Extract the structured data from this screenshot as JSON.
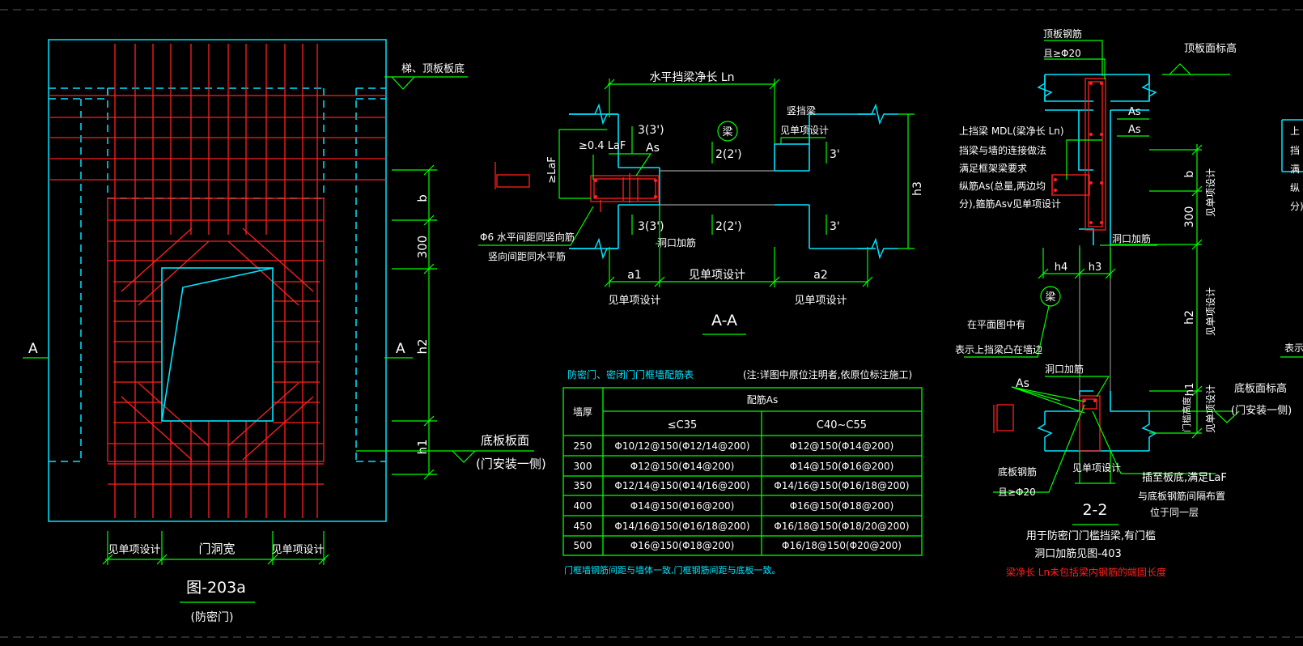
{
  "colors": {
    "background": "#000000",
    "frame_cyan": "#00e5ff",
    "rebar_red": "#ff2020",
    "dim_green": "#00ff00",
    "text_white": "#ffffff",
    "table_green": "#00ff00",
    "note_red": "#ff2020",
    "marker_red": "#ff2020"
  },
  "elevation": {
    "label_top": "梯、顶板板底",
    "label_bottom_1": "底板板面",
    "label_bottom_2": "(门安装一侧)",
    "section_left": "A",
    "section_right": "A",
    "dim_b": "b",
    "dim_300": "300",
    "dim_h2": "h2",
    "dim_h1": "h1",
    "dim_left": "见单项设计",
    "dim_mid": "门洞宽",
    "dim_right": "见单项设计",
    "fig_no": "图-203a",
    "fig_name": "(防密门)"
  },
  "section_aa": {
    "title": "A-A",
    "top_dim": "水平挡梁净长 Ln",
    "beam_mark": "梁",
    "lbl_33_top": "3(3')",
    "lbl_22_top": "2(2')",
    "lbl_3p_top": "3'",
    "lbl_33_bot": "3(3')",
    "lbl_22_bot": "2(2')",
    "lbl_3p_bot": "3'",
    "lbl_04laf": "≥0.4 LaF",
    "lbl_as": "As",
    "lbl_laf": "≥LaF",
    "lbl_vert_1": "竖挡梁",
    "lbl_vert_2": "见单项设计",
    "lbl_h3": "h3",
    "lbl_phi6_1": "Φ6 水平间距同竖向筋",
    "lbl_phi6_2": "竖向间距同水平筋",
    "lbl_opening": "洞口加筋",
    "dim_a1": "a1",
    "dim_mid": "见单项设计",
    "dim_a2": "a2",
    "dim_bot_left": "见单项设计",
    "dim_bot_right": "见单项设计"
  },
  "table": {
    "title": "防密门、密闭门门框墙配筋表",
    "note": "(注:详图中原位注明者,依原位标注施工)",
    "col_wall": "墙厚",
    "col_as": "配筋As",
    "col_c35": "≤C35",
    "col_c40": "C40~C55",
    "rows": [
      {
        "wall": "250",
        "c35": "Φ10/12@150(Φ12/14@200)",
        "c40": "Φ12@150(Φ14@200)"
      },
      {
        "wall": "300",
        "c35": "Φ12@150(Φ14@200)",
        "c40": "Φ14@150(Φ16@200)"
      },
      {
        "wall": "350",
        "c35": "Φ12/14@150(Φ14/16@200)",
        "c40": "Φ14/16@150(Φ16/18@200)"
      },
      {
        "wall": "400",
        "c35": "Φ14@150(Φ16@200)",
        "c40": "Φ16@150(Φ18@200)"
      },
      {
        "wall": "450",
        "c35": "Φ14/16@150(Φ16/18@200)",
        "c40": "Φ16/18@150(Φ18/20@200)"
      },
      {
        "wall": "500",
        "c35": "Φ16@150(Φ18@200)",
        "c40": "Φ16/18@150(Φ20@200)"
      }
    ],
    "footnote": "门框墙钢筋间距与墙体一致,门框钢筋间距与底板一致。"
  },
  "section_22": {
    "title": "2-2",
    "top_steel_1": "顶板钢筋",
    "top_steel_2": "且≥Φ20",
    "top_elev": "顶板面标高",
    "as1": "As",
    "as2": "As",
    "beam_note_1": "上挡梁 MDL(梁净长 Ln)",
    "beam_note_2": "挡梁与墙的连接做法",
    "beam_note_3": "满足框架梁要求",
    "beam_note_4": "纵筋As(总量,两边均",
    "beam_note_5": "分),箍筋Asv见单项设计",
    "dim_b": "b",
    "dim_b_note": "见单项设计",
    "dim_300": "300",
    "opening": "洞口加筋",
    "h4": "h4",
    "h3": "h3",
    "beam_mark": "梁",
    "plan_note_1": "在平面图中有",
    "plan_note_2": "表示上挡梁凸在墙边",
    "dim_h2": "h2",
    "dim_h2_note": "见单项设计",
    "opening2": "洞口加筋",
    "as_low": "As",
    "dim_h1": "h1",
    "door_h": "门槛高度",
    "dim_h1_note": "见单项设计",
    "bottom_elev_1": "底板面标高",
    "bottom_elev_2": "(门安装一侧)",
    "bot_steel_1": "底板钢筋",
    "bot_steel_2": "且≥Φ20",
    "sill_dim": "见单项设计",
    "anchor_1": "插至板底,满足LaF",
    "anchor_2": "与底板钢筋间隔布置",
    "anchor_3": "位于同一层",
    "caption_1": "用于防密门门槛挡梁,有门槛",
    "caption_2": "洞口加筋见图-403",
    "caption_red": "梁净长 Ln未包括梁内钢筋的端固长度"
  },
  "edge": {
    "e1": "上",
    "e2": "挡",
    "e3": "满",
    "e4": "纵",
    "e5": "分)",
    "e6": "表示"
  }
}
